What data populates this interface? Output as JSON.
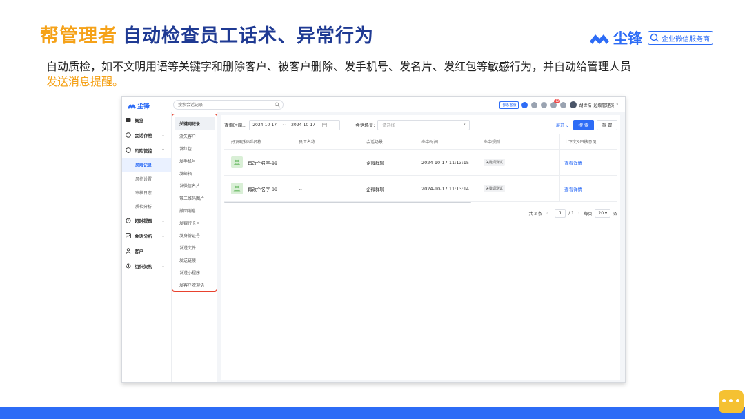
{
  "slide": {
    "title_accent": "帮管理者",
    "title_main": "自动检查员工话术、异常行为",
    "brand_name": "尘锋",
    "brand_tag": "企业微信服务商",
    "desc_main": "自动质检，如不文明用语等关键字和删除客户、被客户删除、发手机号、发名片、发红包等敏感行为，并自动给管理人员",
    "desc_highlight": "发送消息提醒。"
  },
  "app": {
    "logo_text": "尘锋",
    "search_placeholder": "搜索会话记录",
    "dept_button": "部系客服",
    "notification_count": "12",
    "user_name": "胡世浩",
    "user_role": "超级管理员"
  },
  "sidebar": {
    "items": [
      {
        "label": "概览",
        "icon": "overview-icon"
      },
      {
        "label": "会话存档",
        "icon": "chat-icon"
      },
      {
        "label": "风险管控",
        "icon": "shield-icon"
      },
      {
        "label": "超时提醒",
        "icon": "clock-icon"
      },
      {
        "label": "会话分析",
        "icon": "chart-icon"
      },
      {
        "label": "客户",
        "icon": "person-icon"
      },
      {
        "label": "组织架构",
        "icon": "gear-icon"
      }
    ],
    "risk_subitems": [
      "风险记录",
      "风控设置",
      "审核日志",
      "质检分析"
    ]
  },
  "subnav": {
    "items": [
      "关键词记录",
      "流失客户",
      "发红包",
      "发手机号",
      "发邮箱",
      "发微信名片",
      "带二维码图片",
      "撤回消息",
      "发银行卡号",
      "发身份证号",
      "发送文件",
      "发送链接",
      "发送小程序",
      "发客户欢迎语"
    ]
  },
  "filters": {
    "time_label": "查询时间...",
    "date_start": "2024-10-17",
    "date_sep": "~",
    "date_end": "2024-10-17",
    "scene_label": "会话场景:",
    "scene_placeholder": "请选择",
    "expand_label": "展开",
    "search_button": "搜 索",
    "reset_button": "重 置"
  },
  "table": {
    "headers": [
      "好友昵称/群名称",
      "员工名称",
      "会话场景",
      "命中时间",
      "命中规则",
      "上下文&审核意见"
    ],
    "rows": [
      {
        "name": "再改个名字-99",
        "employee": "--",
        "scene": "企微群聊",
        "time": "2024-10-17 11:13:15",
        "rule": "关键词测试",
        "action": "查看详情"
      },
      {
        "name": "再改个名字-99",
        "employee": "--",
        "scene": "企微群聊",
        "time": "2024-10-17 11:13:14",
        "rule": "关键词测试",
        "action": "查看详情"
      }
    ]
  },
  "pagination": {
    "total": "共 2 条",
    "prev": "‹",
    "current": "1",
    "of": "/ 1",
    "next": "›",
    "per_page_label": "每页",
    "per_page": "20",
    "unit": "条"
  },
  "colors": {
    "accent": "#f5a219",
    "title_blue": "#1f3a93",
    "brand_blue": "#2d6cf6",
    "highlight_border": "#e8422e"
  }
}
